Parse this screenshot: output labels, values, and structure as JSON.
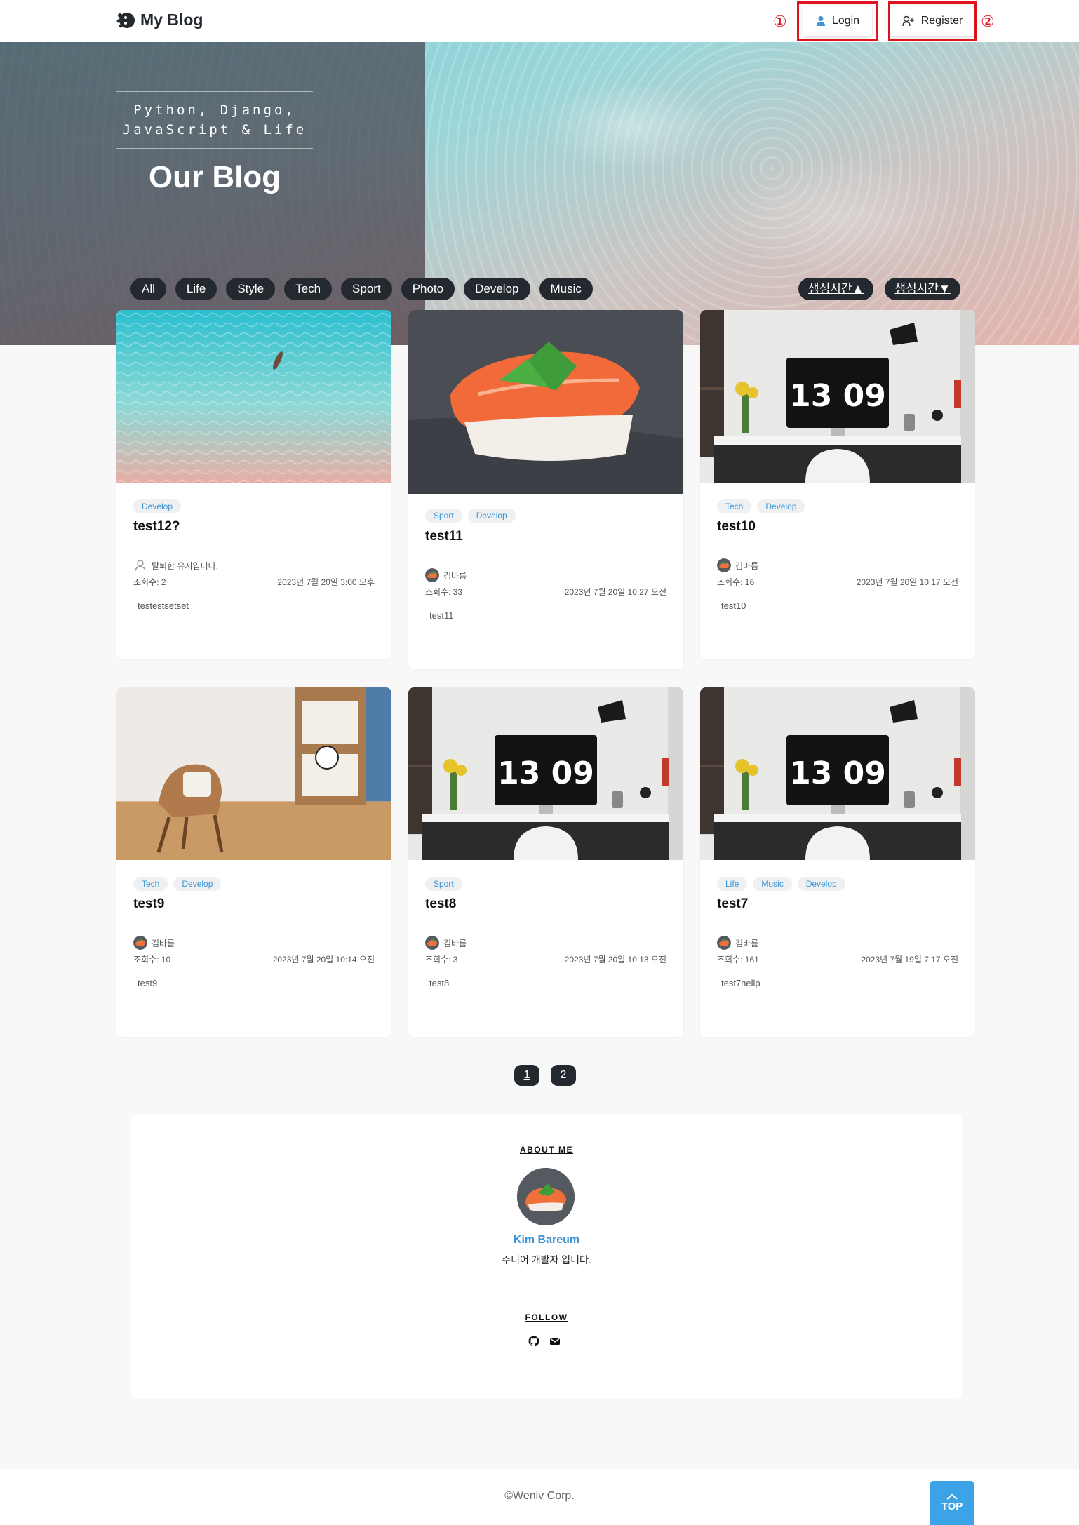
{
  "header": {
    "logo_text": "My Blog",
    "login_label": "Login",
    "register_label": "Register",
    "marker_login": "①",
    "marker_register": "②"
  },
  "hero": {
    "subtitle_line1": "Python, Django,",
    "subtitle_line2": "JavaScript & Life",
    "title": "Our Blog"
  },
  "categories": [
    "All",
    "Life",
    "Style",
    "Tech",
    "Sport",
    "Photo",
    "Develop",
    "Music"
  ],
  "sort": {
    "asc_label": "생성시간▲",
    "desc_label": "생성시간▼"
  },
  "posts": [
    {
      "image": "aerial-beach",
      "tags": [
        "Develop"
      ],
      "title": "test12?",
      "author": "탈퇴한 유저입니다.",
      "author_icon": "anonymous-user-icon",
      "views": "조회수: 2",
      "date": "2023년 7월 20일 3:00 오후",
      "excerpt": "testestsetset"
    },
    {
      "image": "salmon-sushi",
      "tags": [
        "Sport",
        "Develop"
      ],
      "title": "test11",
      "author": "김바름",
      "author_icon": "sushi-avatar",
      "views": "조회수: 33",
      "date": "2023년 7월 20일 10:27 오전",
      "excerpt": "test11"
    },
    {
      "image": "desk-monitor",
      "tags": [
        "Tech",
        "Develop"
      ],
      "title": "test10",
      "author": "김바름",
      "author_icon": "sushi-avatar",
      "views": "조회수: 16",
      "date": "2023년 7월 20일 10:17 오전",
      "excerpt": "test10"
    },
    {
      "image": "chair-room",
      "tags": [
        "Tech",
        "Develop"
      ],
      "title": "test9",
      "author": "김바름",
      "author_icon": "sushi-avatar",
      "views": "조회수: 10",
      "date": "2023년 7월 20일 10:14 오전",
      "excerpt": "test9"
    },
    {
      "image": "desk-monitor",
      "tags": [
        "Sport"
      ],
      "title": "test8",
      "author": "김바름",
      "author_icon": "sushi-avatar",
      "views": "조회수: 3",
      "date": "2023년 7월 20일 10:13 오전",
      "excerpt": "test8"
    },
    {
      "image": "desk-monitor",
      "tags": [
        "Life",
        "Music",
        "Develop"
      ],
      "title": "test7",
      "author": "김바름",
      "author_icon": "sushi-avatar",
      "views": "조회수: 161",
      "date": "2023년 7월 19일 7:17 오전",
      "excerpt": "test7hellp"
    }
  ],
  "monitor_clock": "13 09",
  "pagination": {
    "pages": [
      "1",
      "2"
    ],
    "current": "1"
  },
  "about": {
    "heading": "ABOUT ME",
    "name": "Kim Bareum",
    "bio": "주니어 개발자 입니다.",
    "follow_heading": "FOLLOW",
    "icons": [
      "github-icon",
      "email-icon"
    ]
  },
  "footer": {
    "copyright": "©Weniv Corp.",
    "top_label": "TOP"
  },
  "colors": {
    "dark": "#24292f",
    "accent": "#3b95d6",
    "marker": "#e0141e",
    "top_button": "#3ba3e6"
  }
}
